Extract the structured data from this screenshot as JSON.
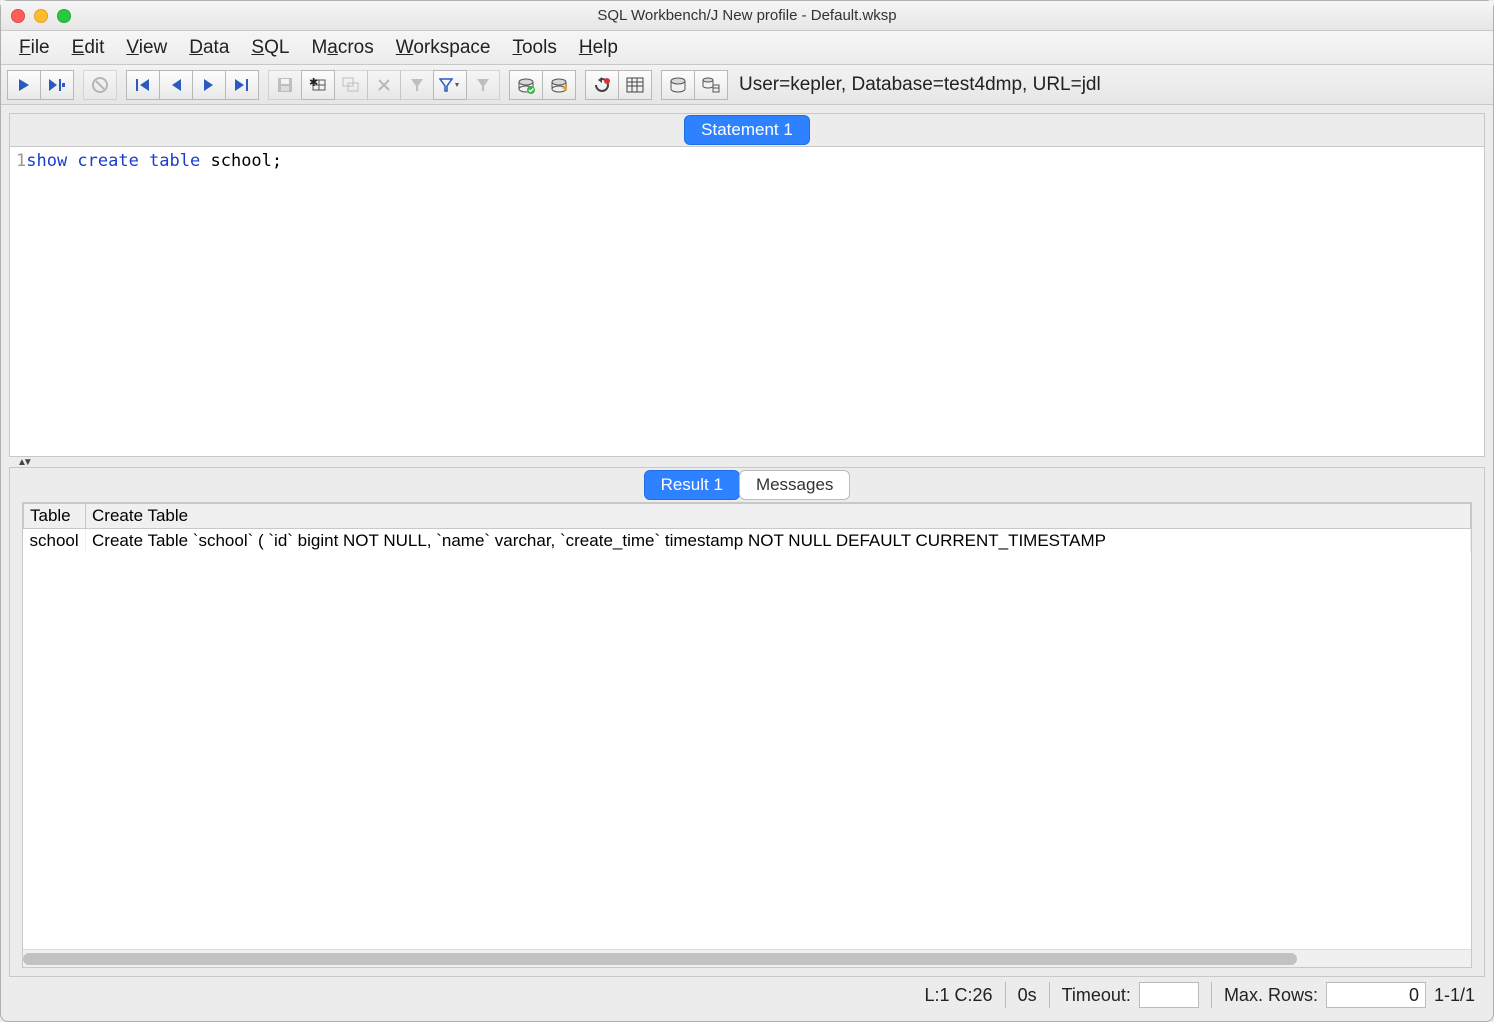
{
  "window": {
    "title": "SQL Workbench/J New profile - Default.wksp"
  },
  "menu": [
    "File",
    "Edit",
    "View",
    "Data",
    "SQL",
    "Macros",
    "Workspace",
    "Tools",
    "Help"
  ],
  "toolbar": {
    "connection_info": "User=kepler, Database=test4dmp, URL=jdl"
  },
  "editor": {
    "tab_label": "Statement 1",
    "line_number": "1",
    "sql_keywords": "show create table",
    "sql_rest": " school;"
  },
  "results": {
    "tab_result": "Result 1",
    "tab_messages": "Messages",
    "columns": [
      "Table",
      "Create Table"
    ],
    "rows": [
      {
        "table": "school",
        "create": "Create Table `school` (  `id` bigint NOT NULL,  `name` varchar,  `create_time` timestamp NOT NULL DEFAULT CURRENT_TIMESTAMP"
      }
    ]
  },
  "status": {
    "cursor": "L:1 C:26",
    "elapsed": "0s",
    "timeout_label": "Timeout:",
    "timeout_value": "",
    "maxrows_label": "Max. Rows:",
    "maxrows_value": "0",
    "row_range": "1-1/1"
  }
}
